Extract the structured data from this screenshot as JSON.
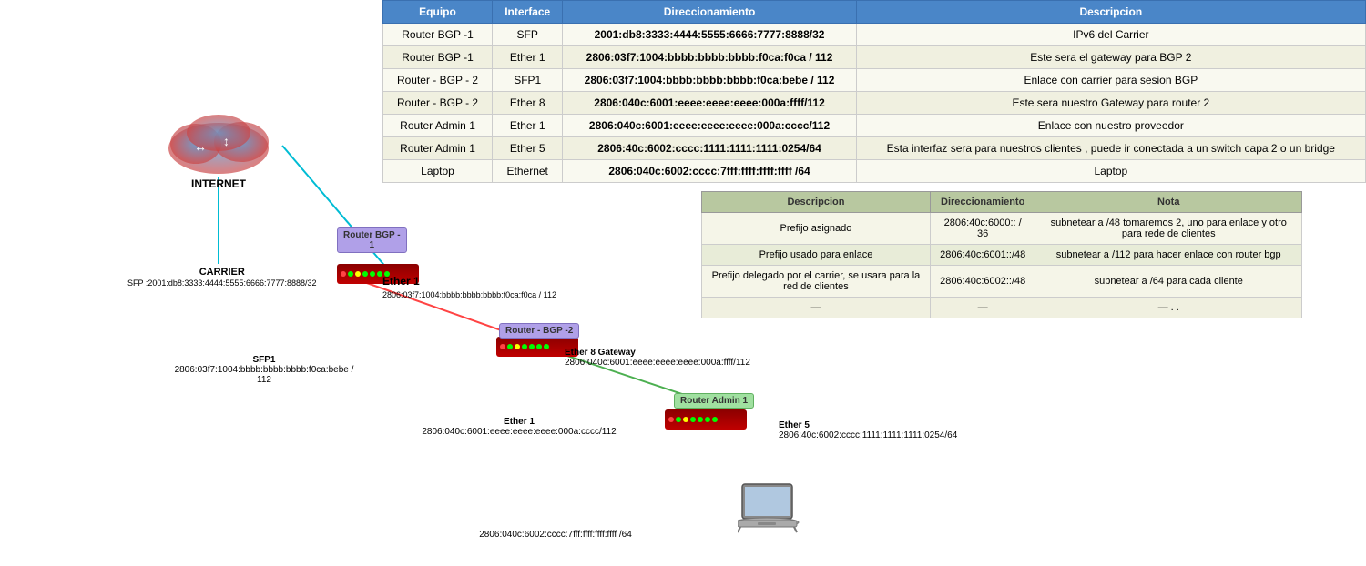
{
  "table": {
    "headers": [
      "Equipo",
      "Interface",
      "Direccionamiento",
      "Descripcion"
    ],
    "rows": [
      {
        "equipo": "Router BGP -1",
        "interface": "SFP",
        "direccionamiento": "2001:db8:3333:4444:5555:6666:7777:8888/32",
        "descripcion": "IPv6 del Carrier"
      },
      {
        "equipo": "Router BGP -1",
        "interface": "Ether 1",
        "direccionamiento": "2806:03f7:1004:bbbb:bbbb:bbbb:f0ca:f0ca / 112",
        "descripcion": "Este sera el gateway para BGP 2"
      },
      {
        "equipo": "Router - BGP - 2",
        "interface": "SFP1",
        "direccionamiento": "2806:03f7:1004:bbbb:bbbb:bbbb:f0ca:bebe / 112",
        "descripcion": "Enlace con carrier para sesion BGP"
      },
      {
        "equipo": "Router - BGP - 2",
        "interface": "Ether 8",
        "direccionamiento": "2806:040c:6001:eeee:eeee:eeee:000a:ffff/112",
        "descripcion": "Este sera nuestro Gateway para router 2"
      },
      {
        "equipo": "Router Admin 1",
        "interface": "Ether 1",
        "direccionamiento": "2806:040c:6001:eeee:eeee:eeee:000a:cccc/112",
        "descripcion": "Enlace con nuestro proveedor"
      },
      {
        "equipo": "Router Admin 1",
        "interface": "Ether 5",
        "direccionamiento": "2806:40c:6002:cccc:1111:1111:1111:0254/64",
        "descripcion": "Esta interfaz sera para nuestros clientes , puede ir conectada a un switch capa 2 o un bridge"
      },
      {
        "equipo": "Laptop",
        "interface": "Ethernet",
        "direccionamiento": "2806:040c:6002:cccc:7fff:ffff:ffff:ffff /64",
        "descripcion": "Laptop"
      }
    ]
  },
  "info_table": {
    "headers": [
      "Descripcion",
      "Direccionamiento",
      "Nota"
    ],
    "rows": [
      {
        "descripcion": "Prefijo asignado",
        "direccionamiento": "2806:40c:6000:: / 36",
        "nota": "subnetear a /48  tomaremos 2, uno para enlace y otro para rede de clientes"
      },
      {
        "descripcion": "Prefijo usado para enlace",
        "direccionamiento": "2806:40c:6001::/48",
        "nota": "subnetear a /112 para hacer enlace con router bgp"
      },
      {
        "descripcion": "Prefijo delegado por el carrier, se usara para la red de clientes",
        "direccionamiento": "2806:40c:6002::/48",
        "nota": "subnetear a /64 para cada cliente"
      },
      {
        "descripcion": "—",
        "direccionamiento": "—",
        "nota": "— . ."
      }
    ]
  },
  "diagram": {
    "internet_label": "INTERNET",
    "carrier_label": "CARRIER",
    "carrier_sfp": "SFP :2001:db8:3333:4444:5555:6666:7777:8888/32",
    "router_bgp1_label": "Router BGP -\n1",
    "router_bgp1_ether1": "Ether 1",
    "router_bgp1_ether1_ip": "2806:03f7:1004:bbbb:bbbb:bbbb:f0ca:f0ca / 112",
    "router_bgp2_label": "Router - BGP -2",
    "router_bgp2_sfp1": "SFP1",
    "router_bgp2_sfp1_ip": "2806:03f7:1004:bbbb:bbbb:bbbb:f0ca:bebe / 112",
    "router_bgp2_ether8": "Ether 8 Gateway",
    "router_bgp2_ether8_ip": "2806:040c:6001:eeee:eeee:eeee:000a:ffff/112",
    "router_admin1_label": "Router Admin 1",
    "router_admin1_ether1": "Ether 1",
    "router_admin1_ether1_ip": "2806:040c:6001:eeee:eeee:eeee:000a:cccc/112",
    "router_admin1_ether5": "Ether 5",
    "router_admin1_ether5_ip": "2806:40c:6002:cccc:1111:1111:1111:0254/64",
    "laptop_ip": "2806:040c:6002:cccc:7fff:ffff:ffff:ffff /64"
  }
}
